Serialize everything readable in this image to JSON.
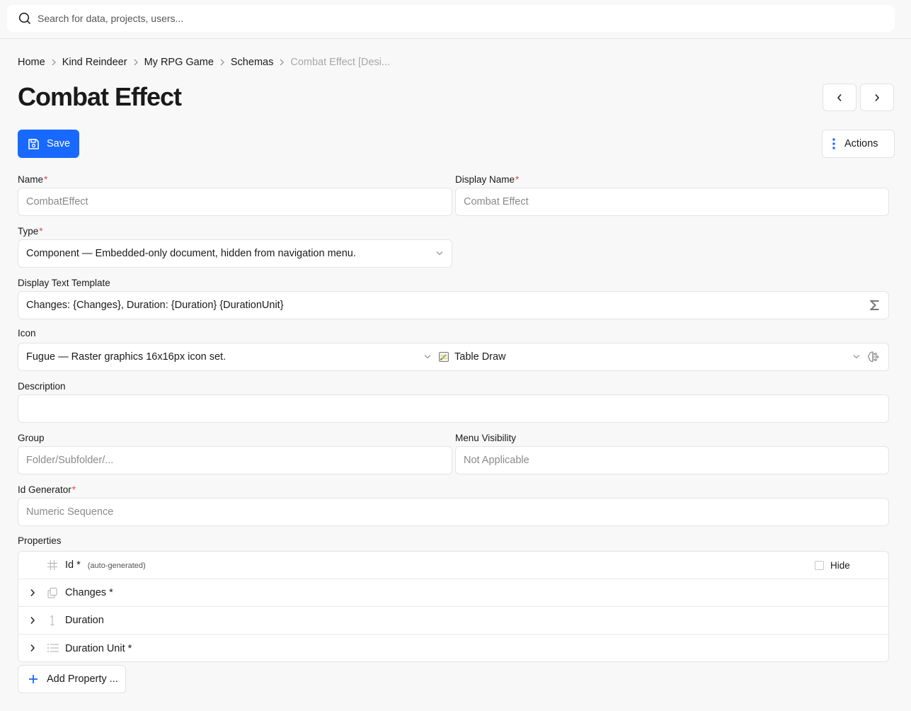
{
  "search": {
    "placeholder": "Search for data, projects, users..."
  },
  "breadcrumb": [
    {
      "label": "Home"
    },
    {
      "label": "Kind Reindeer"
    },
    {
      "label": "My RPG Game"
    },
    {
      "label": "Schemas"
    },
    {
      "label": "Combat Effect [Desi..."
    }
  ],
  "page": {
    "title": "Combat Effect"
  },
  "toolbar": {
    "save_label": "Save",
    "actions_label": "Actions"
  },
  "colors": {
    "primary": "#1769ff",
    "required": "#e04848"
  },
  "form": {
    "name": {
      "label": "Name",
      "required_mark": "*",
      "value": "CombatEffect"
    },
    "display_name": {
      "label": "Display Name",
      "required_mark": "*",
      "value": "Combat Effect"
    },
    "type": {
      "label": "Type",
      "required_mark": "*",
      "value": "Component — Embedded-only document, hidden from navigation menu."
    },
    "display_text_template": {
      "label": "Display Text Template",
      "value": "Changes: {Changes}, Duration: {Duration} {DurationUnit}"
    },
    "icon": {
      "label": "Icon",
      "set_value": "Fugue — Raster graphics 16x16px icon set.",
      "icon_value": "Table Draw"
    },
    "description": {
      "label": "Description",
      "value": ""
    },
    "group": {
      "label": "Group",
      "placeholder": "Folder/Subfolder/..."
    },
    "menu_visibility": {
      "label": "Menu Visibility",
      "value": "Not Applicable"
    },
    "id_generator": {
      "label": "Id Generator",
      "required_mark": "*",
      "value": "Numeric Sequence"
    }
  },
  "properties": {
    "label": "Properties",
    "rows": [
      {
        "name": "Id *",
        "note": "(auto-generated)",
        "hide_label": "Hide",
        "icon": "hash-icon"
      },
      {
        "name": "Changes *",
        "icon": "copy-icon"
      },
      {
        "name": "Duration",
        "icon": "number-icon"
      },
      {
        "name": "Duration Unit *",
        "icon": "list-icon"
      }
    ],
    "add_label": "Add Property ..."
  }
}
